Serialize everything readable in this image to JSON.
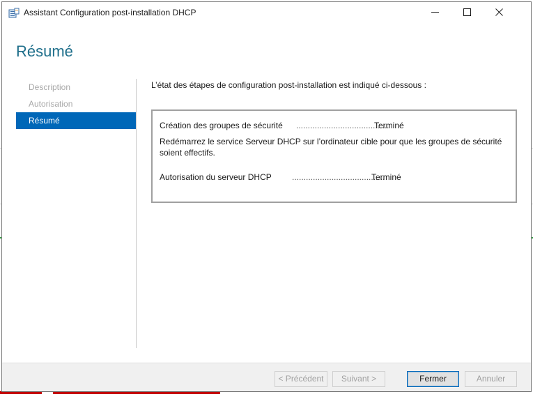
{
  "window": {
    "title": "Assistant Configuration post-installation DHCP",
    "controls": {
      "minimize": "minimize",
      "maximize": "maximize",
      "close": "close"
    }
  },
  "page": {
    "heading": "Résumé",
    "intro": "L’état des étapes de configuration post-installation est indiqué ci-dessous :"
  },
  "nav": {
    "items": [
      {
        "label": "Description",
        "state": "disabled"
      },
      {
        "label": "Autorisation",
        "state": "disabled"
      },
      {
        "label": "Résumé",
        "state": "active"
      }
    ]
  },
  "results": {
    "steps": [
      {
        "label": "Création des groupes de sécurité",
        "dots": "........................................",
        "status": "Terminé"
      },
      {
        "label": "Autorisation du serveur DHCP",
        "dots": "........................................",
        "status": "Terminé"
      }
    ],
    "note": "Redémarrez le service Serveur DHCP sur l’ordinateur cible pour que les groupes de sécurité soient effectifs."
  },
  "footer": {
    "previous": "< Précédent",
    "next": "Suivant >",
    "close": "Fermer",
    "cancel": "Annuler"
  },
  "colors": {
    "heading": "#1f6f8b",
    "nav_active_bg": "#0067b8",
    "nav_disabled_text": "#a8a8a8"
  }
}
